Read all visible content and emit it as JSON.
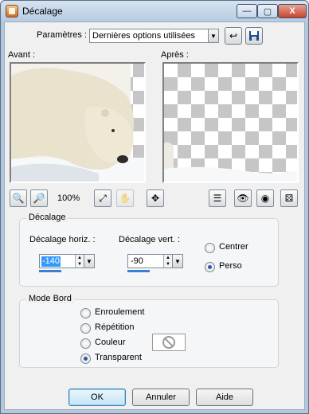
{
  "window": {
    "title": "Décalage"
  },
  "title_buttons": {
    "minimize": "—",
    "maximize": "▢",
    "close": "X"
  },
  "presets": {
    "label": "Paramètres :",
    "value": "Dernières options utilisées"
  },
  "preview": {
    "before_label": "Avant :",
    "after_label": "Après :",
    "zoom": "100%"
  },
  "offset_group": {
    "title": "Décalage",
    "horizontal_label": "Décalage horiz. :",
    "horizontal_value": "-140",
    "vertical_label": "Décalage vert. :",
    "vertical_value": "-90",
    "options": [
      {
        "label": "Centrer",
        "checked": false
      },
      {
        "label": "Perso",
        "checked": true
      }
    ]
  },
  "edge_group": {
    "title": "Mode Bord",
    "options": [
      {
        "label": "Enroulement",
        "checked": false
      },
      {
        "label": "Répétition",
        "checked": false
      },
      {
        "label": "Couleur",
        "checked": false
      },
      {
        "label": "Transparent",
        "checked": true
      }
    ]
  },
  "buttons": {
    "ok": "OK",
    "cancel": "Annuler",
    "help": "Aide"
  },
  "icons": [
    "app-icon",
    "reset-arrow-icon",
    "save-icon",
    "zoom-out-icon",
    "zoom-in-icon",
    "fit-window-icon",
    "hand-pan-icon",
    "move-icon",
    "proof-icon",
    "preview-on-image-icon",
    "eye-icon",
    "randomize-dice-icon",
    "no-color-icon"
  ],
  "colors": {
    "accent": "#3399ff",
    "title_gradient_top": "#d6e3f1",
    "title_gradient_bottom": "#b6cbe1"
  }
}
